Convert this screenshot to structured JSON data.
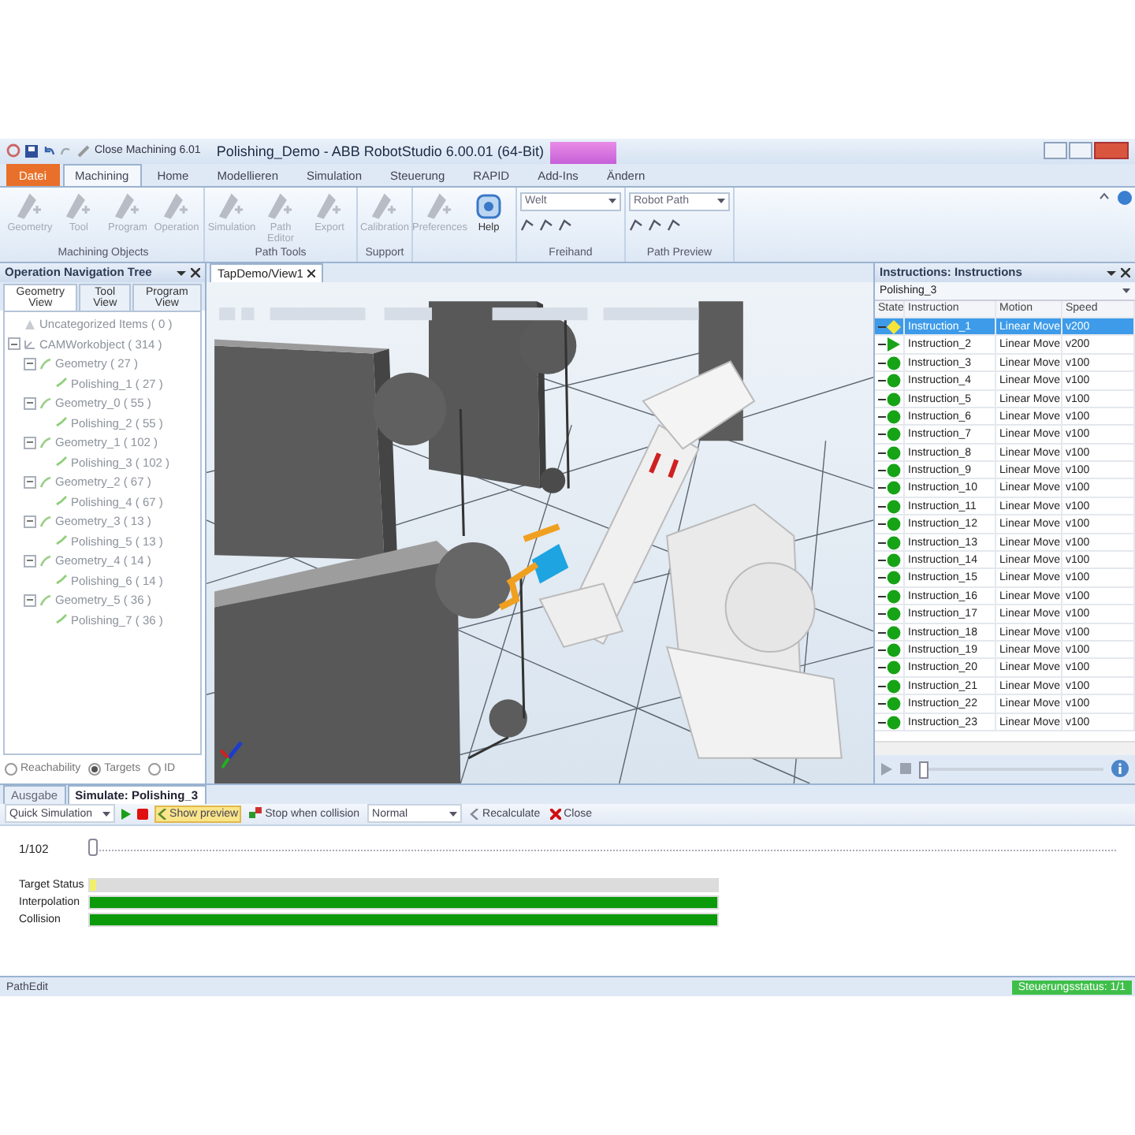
{
  "title_bar": {
    "quick_access_label": "Close Machining 6.01",
    "title": "Polishing_Demo - ABB RobotStudio 6.00.01 (64-Bit)"
  },
  "ribbon_tabs": [
    {
      "label": "Datei",
      "kind": "file",
      "selected": false
    },
    {
      "label": "Machining",
      "kind": "tab",
      "selected": true
    },
    {
      "label": "Home",
      "kind": "tab",
      "selected": false
    },
    {
      "label": "Modellieren",
      "kind": "tab",
      "selected": false
    },
    {
      "label": "Simulation",
      "kind": "tab",
      "selected": false
    },
    {
      "label": "Steuerung",
      "kind": "tab",
      "selected": false
    },
    {
      "label": "RAPID",
      "kind": "tab",
      "selected": false
    },
    {
      "label": "Add-Ins",
      "kind": "tab",
      "selected": false
    },
    {
      "label": "Ändern",
      "kind": "tab",
      "selected": false
    }
  ],
  "ribbon_groups": [
    {
      "label": "Machining Objects",
      "kind": "buttons",
      "buttons": [
        {
          "label": "Geometry",
          "disabled": true
        },
        {
          "label": "Tool",
          "disabled": true
        },
        {
          "label": "Program",
          "disabled": true
        },
        {
          "label": "Operation",
          "disabled": true
        }
      ]
    },
    {
      "label": "Path Tools",
      "kind": "buttons",
      "buttons": [
        {
          "label": "Simulation",
          "disabled": true
        },
        {
          "label": "Path Editor",
          "disabled": true
        },
        {
          "label": "Export",
          "disabled": true
        }
      ]
    },
    {
      "label": "Support",
      "kind": "buttons",
      "buttons": [
        {
          "label": "Calibration",
          "disabled": true
        }
      ]
    },
    {
      "kind": "buttons",
      "buttons": [
        {
          "label": "Preferences",
          "disabled": true
        },
        {
          "label": "Help",
          "disabled": false
        }
      ]
    },
    {
      "label": "Freihand",
      "kind": "tools",
      "dropdown": "Welt"
    },
    {
      "label": "Path Preview",
      "kind": "tools",
      "dropdown": "Robot Path"
    }
  ],
  "navigation_panel": {
    "title": "Operation Navigation Tree",
    "tabs": [
      {
        "label": "Geometry View",
        "selected": true
      },
      {
        "label": "Tool View",
        "selected": false
      },
      {
        "label": "Program View",
        "selected": false
      }
    ],
    "tree": [
      {
        "label": "Uncategorized Items ( 0 )",
        "kind": "folder"
      },
      {
        "label": "CAMWorkobject ( 314 )",
        "kind": "workobject",
        "expanded": true,
        "children": [
          {
            "label": "Geometry ( 27 )",
            "kind": "geometry",
            "expanded": true,
            "children": [
              {
                "label": "Polishing_1 ( 27 )",
                "kind": "path"
              }
            ]
          },
          {
            "label": "Geometry_0 ( 55 )",
            "kind": "geometry",
            "expanded": true,
            "children": [
              {
                "label": "Polishing_2 ( 55 )",
                "kind": "path"
              }
            ]
          },
          {
            "label": "Geometry_1 ( 102 )",
            "kind": "geometry",
            "expanded": true,
            "children": [
              {
                "label": "Polishing_3 ( 102 )",
                "kind": "path"
              }
            ]
          },
          {
            "label": "Geometry_2 ( 67 )",
            "kind": "geometry",
            "expanded": true,
            "children": [
              {
                "label": "Polishing_4 ( 67 )",
                "kind": "path"
              }
            ]
          },
          {
            "label": "Geometry_3 ( 13 )",
            "kind": "geometry",
            "expanded": true,
            "children": [
              {
                "label": "Polishing_5 ( 13 )",
                "kind": "path"
              }
            ]
          },
          {
            "label": "Geometry_4 ( 14 )",
            "kind": "geometry",
            "expanded": true,
            "children": [
              {
                "label": "Polishing_6 ( 14 )",
                "kind": "path"
              }
            ]
          },
          {
            "label": "Geometry_5 ( 36 )",
            "kind": "geometry",
            "expanded": true,
            "children": [
              {
                "label": "Polishing_7 ( 36 )",
                "kind": "path"
              }
            ]
          }
        ]
      }
    ],
    "options": [
      {
        "label": "Reachability",
        "selected": false
      },
      {
        "label": "Targets",
        "selected": true
      },
      {
        "label": "ID",
        "selected": false
      }
    ]
  },
  "viewport": {
    "tab": "TapDemo/View1"
  },
  "instructions_panel": {
    "title": "Instructions: Instructions",
    "path": "Polishing_3",
    "columns": [
      "State",
      "Instruction",
      "Motion",
      "Speed"
    ],
    "rows": [
      {
        "kind": "current",
        "instruction": "Instruction_1",
        "motion": "Linear Move",
        "speed": "v200",
        "selected": true
      },
      {
        "kind": "next",
        "instruction": "Instruction_2",
        "motion": "Linear Move",
        "speed": "v200",
        "selected": false
      },
      {
        "kind": "reached",
        "instruction": "Instruction_3",
        "motion": "Linear Move",
        "speed": "v100",
        "selected": false
      },
      {
        "kind": "reached",
        "instruction": "Instruction_4",
        "motion": "Linear Move",
        "speed": "v100",
        "selected": false
      },
      {
        "kind": "reached",
        "instruction": "Instruction_5",
        "motion": "Linear Move",
        "speed": "v100",
        "selected": false
      },
      {
        "kind": "reached",
        "instruction": "Instruction_6",
        "motion": "Linear Move",
        "speed": "v100",
        "selected": false
      },
      {
        "kind": "reached",
        "instruction": "Instruction_7",
        "motion": "Linear Move",
        "speed": "v100",
        "selected": false
      },
      {
        "kind": "reached",
        "instruction": "Instruction_8",
        "motion": "Linear Move",
        "speed": "v100",
        "selected": false
      },
      {
        "kind": "reached",
        "instruction": "Instruction_9",
        "motion": "Linear Move",
        "speed": "v100",
        "selected": false
      },
      {
        "kind": "reached",
        "instruction": "Instruction_10",
        "motion": "Linear Move",
        "speed": "v100",
        "selected": false
      },
      {
        "kind": "reached",
        "instruction": "Instruction_11",
        "motion": "Linear Move",
        "speed": "v100",
        "selected": false
      },
      {
        "kind": "reached",
        "instruction": "Instruction_12",
        "motion": "Linear Move",
        "speed": "v100",
        "selected": false
      },
      {
        "kind": "reached",
        "instruction": "Instruction_13",
        "motion": "Linear Move",
        "speed": "v100",
        "selected": false
      },
      {
        "kind": "reached",
        "instruction": "Instruction_14",
        "motion": "Linear Move",
        "speed": "v100",
        "selected": false
      },
      {
        "kind": "reached",
        "instruction": "Instruction_15",
        "motion": "Linear Move",
        "speed": "v100",
        "selected": false
      },
      {
        "kind": "reached",
        "instruction": "Instruction_16",
        "motion": "Linear Move",
        "speed": "v100",
        "selected": false
      },
      {
        "kind": "reached",
        "instruction": "Instruction_17",
        "motion": "Linear Move",
        "speed": "v100",
        "selected": false
      },
      {
        "kind": "reached",
        "instruction": "Instruction_18",
        "motion": "Linear Move",
        "speed": "v100",
        "selected": false
      },
      {
        "kind": "reached",
        "instruction": "Instruction_19",
        "motion": "Linear Move",
        "speed": "v100",
        "selected": false
      },
      {
        "kind": "reached",
        "instruction": "Instruction_20",
        "motion": "Linear Move",
        "speed": "v100",
        "selected": false
      },
      {
        "kind": "reached",
        "instruction": "Instruction_21",
        "motion": "Linear Move",
        "speed": "v100",
        "selected": false
      },
      {
        "kind": "reached",
        "instruction": "Instruction_22",
        "motion": "Linear Move",
        "speed": "v100",
        "selected": false
      },
      {
        "kind": "reached",
        "instruction": "Instruction_23",
        "motion": "Linear Move",
        "speed": "v100",
        "selected": false
      }
    ],
    "progress": {
      "level": 0.0
    }
  },
  "bottom_panel": {
    "tabs": [
      {
        "label": "Ausgabe",
        "selected": false
      },
      {
        "label": "Simulate: Polishing_3",
        "selected": true
      }
    ],
    "toolbar": {
      "mode": "Quick Simulation",
      "show_preview": {
        "label": "Show preview",
        "on": true
      },
      "stop_when_collision": "Stop when collision",
      "speed": "Normal",
      "recalculate": "Recalculate",
      "close": "Close"
    },
    "position": "1/102",
    "slider": {
      "level": 0.0
    },
    "bars": [
      {
        "label": "Target Status",
        "level": 0.01,
        "color": "#f2f06a"
      },
      {
        "label": "Interpolation",
        "level": 1.0,
        "color": "#0a9a0a"
      },
      {
        "label": "Collision",
        "level": 1.0,
        "color": "#0a9a0a"
      }
    ]
  },
  "status_bar": {
    "left": "PathEdit",
    "right": "Steuerungsstatus: 1/1"
  }
}
